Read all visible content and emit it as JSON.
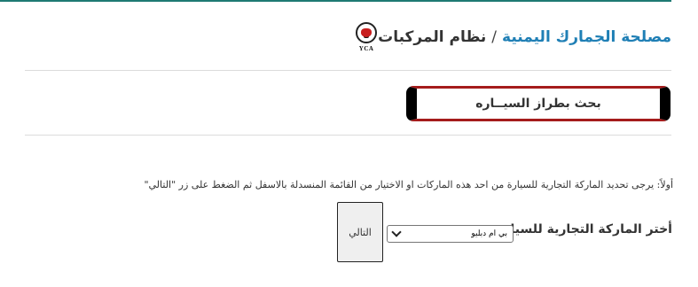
{
  "header": {
    "logo_text": "YCA",
    "org_name": "مصلحة الجمارك اليمنية",
    "separator": "/",
    "system_name": "نظام المركبات"
  },
  "search_tab": {
    "label": "بحث بطراز السيــاره"
  },
  "instructions": {
    "text": "أولاً: يرجى تحديد الماركة التجارية للسيارة من احد هذه الماركات او الاختيار من القائمة المنسدلة بالاسفل ثم الضغط على زر \"التالي\""
  },
  "brand_form": {
    "label": "أختر الماركة التجارية للسيارة:",
    "selected_brand": "بي ام دبليو",
    "next_button_label": "التالي"
  },
  "colors": {
    "top_rule": "#1e7a73",
    "link": "#1f7fb5",
    "tab_border_accent": "#a51c1c",
    "logo_red": "#c81e1e"
  }
}
